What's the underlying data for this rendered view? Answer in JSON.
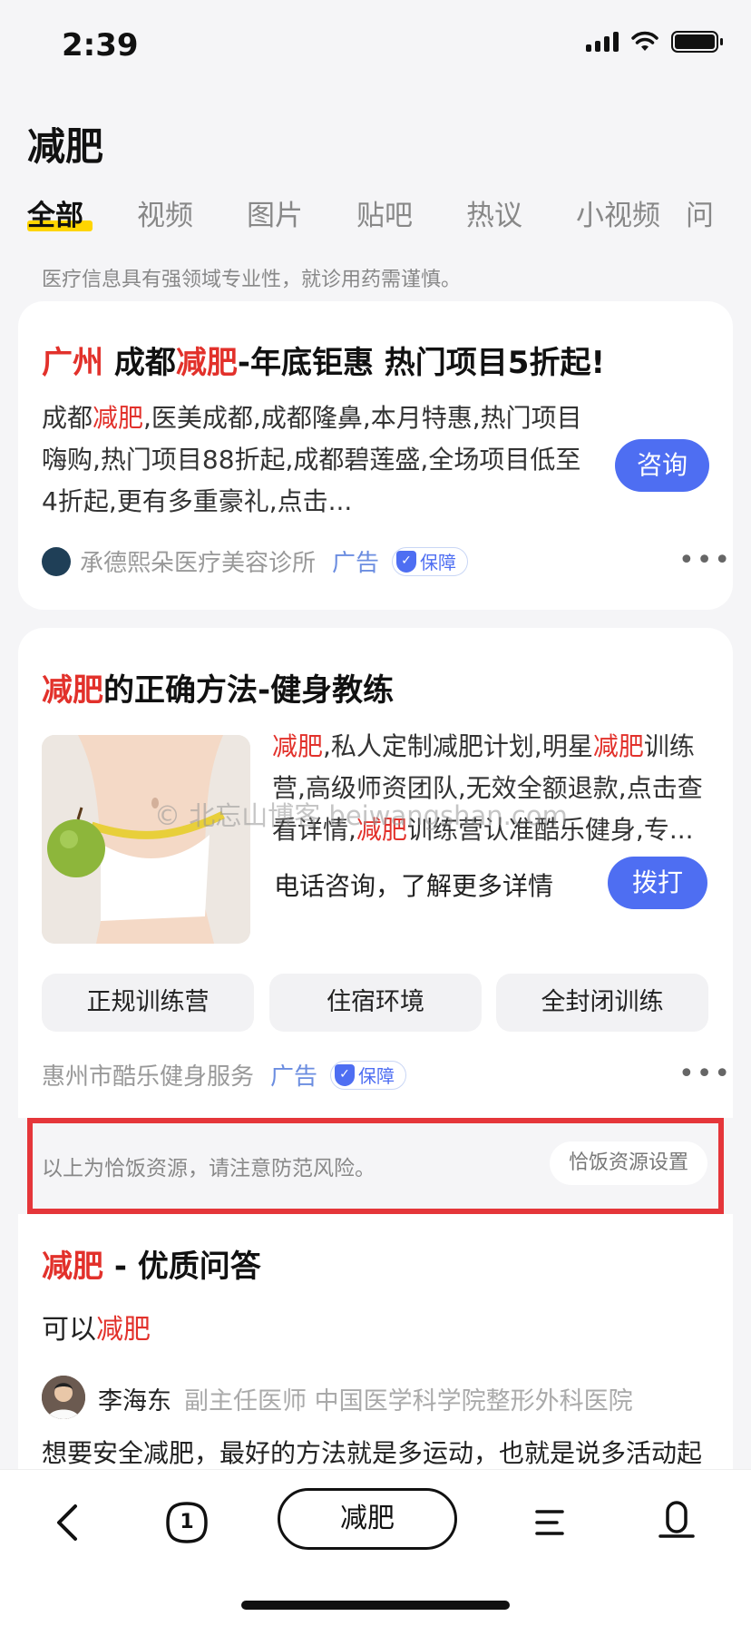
{
  "status_bar": {
    "time": "2:39"
  },
  "header": {
    "title": "减肥",
    "tabs": [
      "全部",
      "视频",
      "图片",
      "贴吧",
      "热议",
      "小视频",
      "问"
    ],
    "notice": "医疗信息具有强领域专业性，就诊用药需谨慎。"
  },
  "ad1": {
    "title_city": "广州",
    "title_mid": " 成都",
    "title_keyword": "减肥",
    "title_rest": "-年底钜惠 热门项目5折起!",
    "desc_pre": "成都",
    "desc_keyword": "减肥",
    "desc_rest": ",医美成都,成都隆鼻,本月特惠,热门项目嗨购,热门项目88折起,成都碧莲盛,全场项目低至4折起,更有多重豪礼,点击...",
    "consult_label": "咨询",
    "advertiser": "承德熙朵医疗美容诊所",
    "ad_label": "广告",
    "badge": "保障"
  },
  "ad2": {
    "title_keyword": "减肥",
    "title_rest": "的正确方法-健身教练",
    "desc_k1": "减肥",
    "desc_t1": ",私人定制减肥计划,明星",
    "desc_k2": "减肥",
    "desc_t2": "训练营,高级师资团队,无效全额退款,点击查看详情,",
    "desc_k3": "减肥",
    "desc_t3": "训练营认准酷乐健身,专...",
    "phone_text": "电话咨询，了解更多详情",
    "call_label": "拨打",
    "chips": [
      "正规训练营",
      "住宿环境",
      "全封闭训练"
    ],
    "advertiser": "惠州市酷乐健身服务",
    "ad_label": "广告",
    "badge": "保障"
  },
  "hf_notice": {
    "text": "以上为恰饭资源，请注意防范风险。",
    "settings_label": "恰饭资源设置"
  },
  "qa": {
    "title_keyword": "减肥",
    "title_rest": " - 优质问答",
    "sub_pre": "可以",
    "sub_keyword": "减肥",
    "author": "李海东",
    "author_meta": "副主任医师 中国医学科学院整形外科医院",
    "body": "想要安全减肥，最好的方法就是多运动，也就是说多活动起"
  },
  "watermark": "© 北忘山博客 beiwangshan.com",
  "bottom_bar": {
    "tab_count": "1",
    "search_query": "减肥"
  },
  "colors": {
    "accent": "#4e6ef2",
    "keyword_red": "#e2312b",
    "highlight": "#e5363a"
  }
}
